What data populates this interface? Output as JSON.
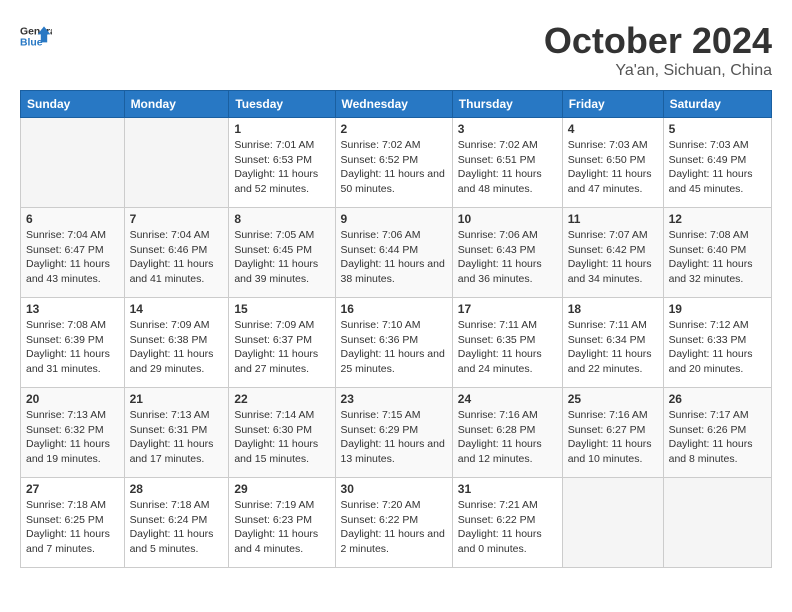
{
  "header": {
    "logo_line1": "General",
    "logo_line2": "Blue",
    "title": "October 2024",
    "subtitle": "Ya'an, Sichuan, China"
  },
  "weekdays": [
    "Sunday",
    "Monday",
    "Tuesday",
    "Wednesday",
    "Thursday",
    "Friday",
    "Saturday"
  ],
  "weeks": [
    [
      {
        "day": "",
        "info": ""
      },
      {
        "day": "",
        "info": ""
      },
      {
        "day": "1",
        "info": "Sunrise: 7:01 AM\nSunset: 6:53 PM\nDaylight: 11 hours and 52 minutes."
      },
      {
        "day": "2",
        "info": "Sunrise: 7:02 AM\nSunset: 6:52 PM\nDaylight: 11 hours and 50 minutes."
      },
      {
        "day": "3",
        "info": "Sunrise: 7:02 AM\nSunset: 6:51 PM\nDaylight: 11 hours and 48 minutes."
      },
      {
        "day": "4",
        "info": "Sunrise: 7:03 AM\nSunset: 6:50 PM\nDaylight: 11 hours and 47 minutes."
      },
      {
        "day": "5",
        "info": "Sunrise: 7:03 AM\nSunset: 6:49 PM\nDaylight: 11 hours and 45 minutes."
      }
    ],
    [
      {
        "day": "6",
        "info": "Sunrise: 7:04 AM\nSunset: 6:47 PM\nDaylight: 11 hours and 43 minutes."
      },
      {
        "day": "7",
        "info": "Sunrise: 7:04 AM\nSunset: 6:46 PM\nDaylight: 11 hours and 41 minutes."
      },
      {
        "day": "8",
        "info": "Sunrise: 7:05 AM\nSunset: 6:45 PM\nDaylight: 11 hours and 39 minutes."
      },
      {
        "day": "9",
        "info": "Sunrise: 7:06 AM\nSunset: 6:44 PM\nDaylight: 11 hours and 38 minutes."
      },
      {
        "day": "10",
        "info": "Sunrise: 7:06 AM\nSunset: 6:43 PM\nDaylight: 11 hours and 36 minutes."
      },
      {
        "day": "11",
        "info": "Sunrise: 7:07 AM\nSunset: 6:42 PM\nDaylight: 11 hours and 34 minutes."
      },
      {
        "day": "12",
        "info": "Sunrise: 7:08 AM\nSunset: 6:40 PM\nDaylight: 11 hours and 32 minutes."
      }
    ],
    [
      {
        "day": "13",
        "info": "Sunrise: 7:08 AM\nSunset: 6:39 PM\nDaylight: 11 hours and 31 minutes."
      },
      {
        "day": "14",
        "info": "Sunrise: 7:09 AM\nSunset: 6:38 PM\nDaylight: 11 hours and 29 minutes."
      },
      {
        "day": "15",
        "info": "Sunrise: 7:09 AM\nSunset: 6:37 PM\nDaylight: 11 hours and 27 minutes."
      },
      {
        "day": "16",
        "info": "Sunrise: 7:10 AM\nSunset: 6:36 PM\nDaylight: 11 hours and 25 minutes."
      },
      {
        "day": "17",
        "info": "Sunrise: 7:11 AM\nSunset: 6:35 PM\nDaylight: 11 hours and 24 minutes."
      },
      {
        "day": "18",
        "info": "Sunrise: 7:11 AM\nSunset: 6:34 PM\nDaylight: 11 hours and 22 minutes."
      },
      {
        "day": "19",
        "info": "Sunrise: 7:12 AM\nSunset: 6:33 PM\nDaylight: 11 hours and 20 minutes."
      }
    ],
    [
      {
        "day": "20",
        "info": "Sunrise: 7:13 AM\nSunset: 6:32 PM\nDaylight: 11 hours and 19 minutes."
      },
      {
        "day": "21",
        "info": "Sunrise: 7:13 AM\nSunset: 6:31 PM\nDaylight: 11 hours and 17 minutes."
      },
      {
        "day": "22",
        "info": "Sunrise: 7:14 AM\nSunset: 6:30 PM\nDaylight: 11 hours and 15 minutes."
      },
      {
        "day": "23",
        "info": "Sunrise: 7:15 AM\nSunset: 6:29 PM\nDaylight: 11 hours and 13 minutes."
      },
      {
        "day": "24",
        "info": "Sunrise: 7:16 AM\nSunset: 6:28 PM\nDaylight: 11 hours and 12 minutes."
      },
      {
        "day": "25",
        "info": "Sunrise: 7:16 AM\nSunset: 6:27 PM\nDaylight: 11 hours and 10 minutes."
      },
      {
        "day": "26",
        "info": "Sunrise: 7:17 AM\nSunset: 6:26 PM\nDaylight: 11 hours and 8 minutes."
      }
    ],
    [
      {
        "day": "27",
        "info": "Sunrise: 7:18 AM\nSunset: 6:25 PM\nDaylight: 11 hours and 7 minutes."
      },
      {
        "day": "28",
        "info": "Sunrise: 7:18 AM\nSunset: 6:24 PM\nDaylight: 11 hours and 5 minutes."
      },
      {
        "day": "29",
        "info": "Sunrise: 7:19 AM\nSunset: 6:23 PM\nDaylight: 11 hours and 4 minutes."
      },
      {
        "day": "30",
        "info": "Sunrise: 7:20 AM\nSunset: 6:22 PM\nDaylight: 11 hours and 2 minutes."
      },
      {
        "day": "31",
        "info": "Sunrise: 7:21 AM\nSunset: 6:22 PM\nDaylight: 11 hours and 0 minutes."
      },
      {
        "day": "",
        "info": ""
      },
      {
        "day": "",
        "info": ""
      }
    ]
  ]
}
